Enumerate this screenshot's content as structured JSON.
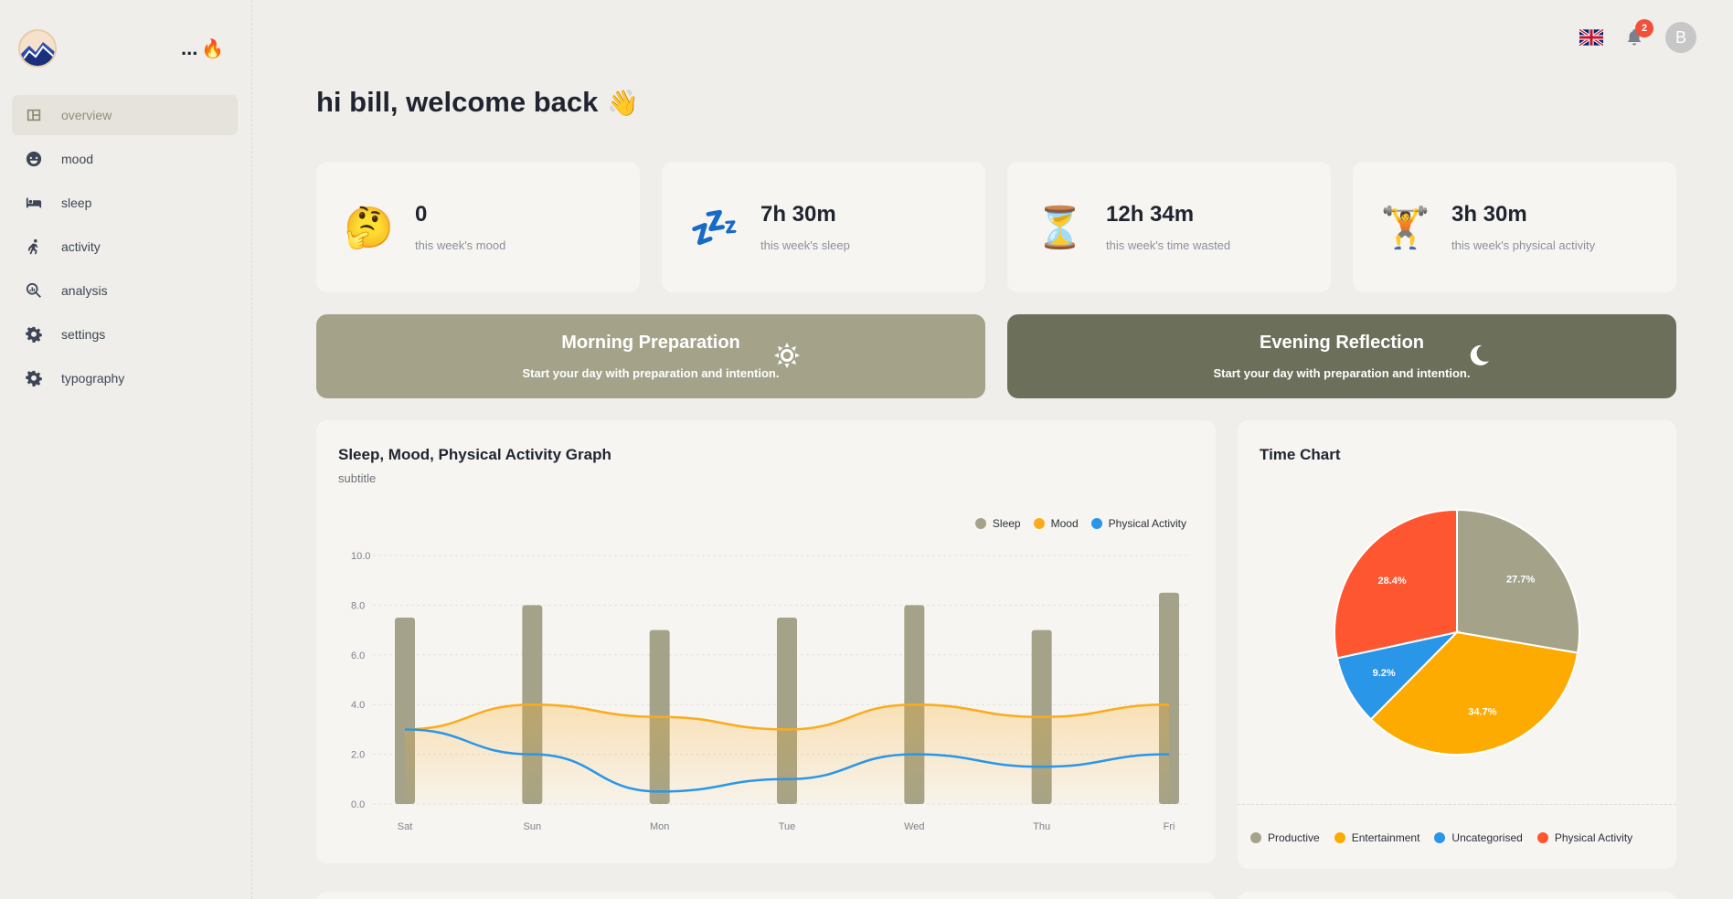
{
  "sidebar": {
    "streak_dots": "...",
    "streak_icon": "🔥",
    "items": [
      {
        "label": "overview",
        "icon": "layout-icon",
        "active": true
      },
      {
        "label": "mood",
        "icon": "smiley-icon",
        "active": false
      },
      {
        "label": "sleep",
        "icon": "bed-icon",
        "active": false
      },
      {
        "label": "activity",
        "icon": "running-icon",
        "active": false
      },
      {
        "label": "analysis",
        "icon": "search-analysis-icon",
        "active": false
      },
      {
        "label": "settings",
        "icon": "gear-icon",
        "active": false
      },
      {
        "label": "typography",
        "icon": "gear-icon",
        "active": false
      }
    ]
  },
  "topbar": {
    "notification_count": "2",
    "avatar_initial": "B",
    "language_flag": "uk-flag-icon"
  },
  "greeting": {
    "text": "hi bill, welcome back",
    "emoji": "👋"
  },
  "stats": [
    {
      "emoji": "🤔",
      "value": "0",
      "label": "this week's mood"
    },
    {
      "emoji": "💤",
      "value": "7h 30m",
      "label": "this week's sleep"
    },
    {
      "emoji": "⏳",
      "value": "12h 34m",
      "label": "this week's time wasted"
    },
    {
      "emoji": "🏋",
      "value": "3h 30m",
      "label": "this week's physical activity"
    }
  ],
  "banners": {
    "morning": {
      "title": "Morning Preparation",
      "subtitle": "Start your day with preparation and intention.",
      "color": "#a4a38a"
    },
    "evening": {
      "title": "Evening Reflection",
      "subtitle": "Start your day with preparation and intention.",
      "color": "#6c705b"
    }
  },
  "colors": {
    "sleep": "#a4a38a",
    "mood": "#fbab1c",
    "physical": "#2a96e8",
    "productive": "#a4a38a",
    "entertainment": "#fdab00",
    "uncategorised": "#2a96e8",
    "physical_activity": "#fe5631"
  },
  "chart_data": [
    {
      "type": "bar",
      "title": "Sleep, Mood, Physical Activity Graph",
      "subtitle": "subtitle",
      "categories": [
        "Sat",
        "Sun",
        "Mon",
        "Tue",
        "Wed",
        "Thu",
        "Fri"
      ],
      "ylim": [
        0,
        10
      ],
      "yticks": [
        "0.0",
        "2.0",
        "4.0",
        "6.0",
        "8.0",
        "10.0"
      ],
      "grid": true,
      "legend": "top-right",
      "series": [
        {
          "name": "Sleep",
          "type": "bar",
          "values": [
            7.5,
            8,
            7,
            7.5,
            8,
            7,
            8.5
          ]
        },
        {
          "name": "Mood",
          "type": "area",
          "values": [
            3,
            4,
            3.5,
            3,
            4,
            3.5,
            4
          ]
        },
        {
          "name": "Physical Activity",
          "type": "line",
          "values": [
            3,
            2,
            0.5,
            1,
            2,
            1.5,
            2
          ]
        }
      ]
    },
    {
      "type": "pie",
      "title": "Time Chart",
      "legend": "bottom",
      "slices": [
        {
          "name": "Productive",
          "value": 27.7,
          "label": "27.7%"
        },
        {
          "name": "Entertainment",
          "value": 34.7,
          "label": "34.7%"
        },
        {
          "name": "Uncategorised",
          "value": 9.2,
          "label": "9.2%"
        },
        {
          "name": "Physical Activity",
          "value": 28.4,
          "label": "28.4%"
        }
      ]
    }
  ]
}
